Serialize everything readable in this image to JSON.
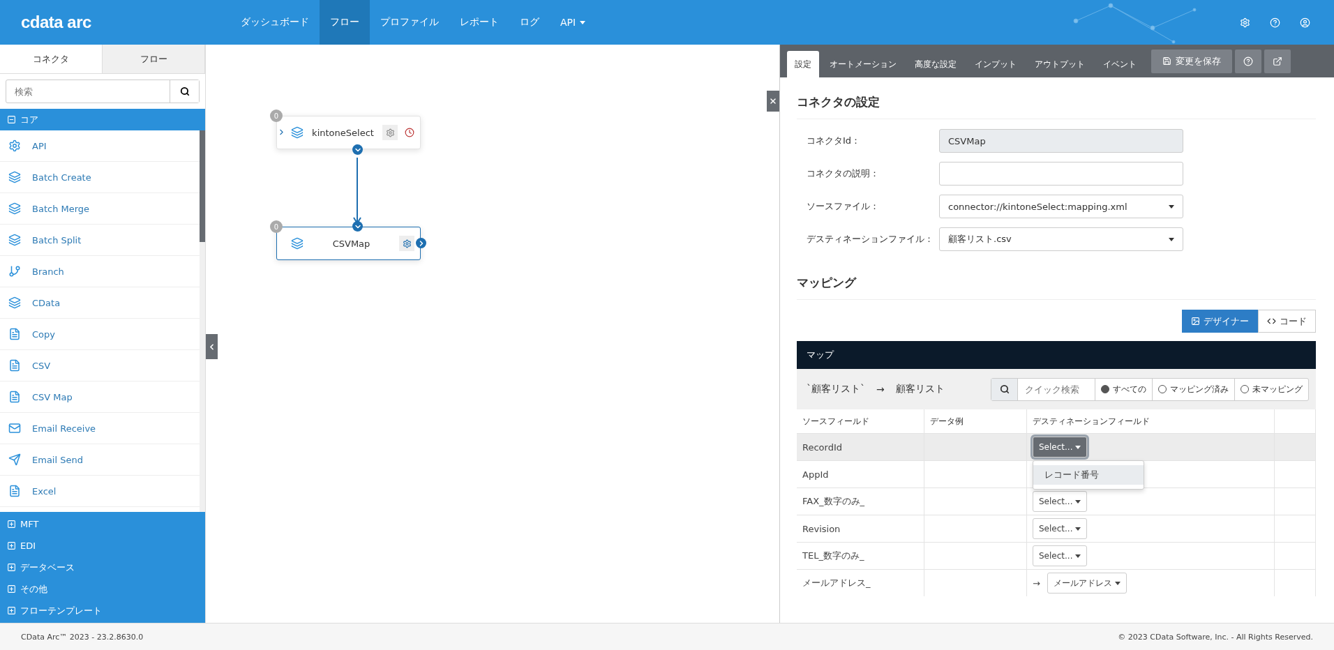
{
  "header": {
    "logo": "cdata arc",
    "nav": [
      {
        "label": "ダッシュボード",
        "selected": false,
        "dropdown": false
      },
      {
        "label": "フロー",
        "selected": true,
        "dropdown": false
      },
      {
        "label": "プロファイル",
        "selected": false,
        "dropdown": false
      },
      {
        "label": "レポート",
        "selected": false,
        "dropdown": false
      },
      {
        "label": "ログ",
        "selected": false,
        "dropdown": false
      },
      {
        "label": "API",
        "selected": false,
        "dropdown": true
      }
    ]
  },
  "sidebar": {
    "tabs": [
      {
        "label": "コネクタ",
        "selected": true
      },
      {
        "label": "フロー",
        "selected": false
      }
    ],
    "search": {
      "placeholder": "検索"
    },
    "groups": [
      {
        "label": "コア",
        "expanded": true,
        "items": [
          "API",
          "Batch Create",
          "Batch Merge",
          "Batch Split",
          "Branch",
          "CData",
          "Copy",
          "CSV",
          "CSV Map",
          "Email Receive",
          "Email Send",
          "Excel"
        ]
      },
      {
        "label": "MFT",
        "expanded": false
      },
      {
        "label": "EDI",
        "expanded": false
      },
      {
        "label": "データベース",
        "expanded": false
      },
      {
        "label": "その他",
        "expanded": false
      },
      {
        "label": "フローテンプレート",
        "expanded": false
      }
    ]
  },
  "canvas": {
    "nodes": [
      {
        "name": "kintoneSelect",
        "badge": "0",
        "selected": false,
        "scheduled": true,
        "has_input": true,
        "has_output": false
      },
      {
        "name": "CSVMap",
        "badge": "0",
        "selected": true,
        "scheduled": false,
        "has_input": false,
        "has_output": true
      }
    ]
  },
  "panel": {
    "tabs": [
      {
        "label": "設定",
        "selected": true
      },
      {
        "label": "オートメーション",
        "selected": false
      },
      {
        "label": "高度な設定",
        "selected": false
      },
      {
        "label": "インプット",
        "selected": false
      },
      {
        "label": "アウトプット",
        "selected": false
      },
      {
        "label": "イベント",
        "selected": false
      }
    ],
    "save_button": "変更を保存",
    "settings_title": "コネクタの設定",
    "fields": [
      {
        "label": "コネクタId：",
        "kind": "readonly",
        "value": "CSVMap"
      },
      {
        "label": "コネクタの説明：",
        "kind": "textarea"
      },
      {
        "label": "ソースファイル：",
        "kind": "select",
        "value": "connector://kintoneSelect:mapping.xml"
      },
      {
        "label": "デスティネーションファイル：",
        "kind": "select",
        "value": "顧客リスト.csv"
      }
    ],
    "mapping_title": "マッピング",
    "view_toggle": [
      {
        "label": "デザイナー",
        "kind": "designer",
        "selected": true
      },
      {
        "label": "コード",
        "kind": "code",
        "selected": false
      }
    ],
    "map": {
      "title": "マップ",
      "source": "`顧客リスト`",
      "arrow": "→",
      "destination": "顧客リスト",
      "search": {
        "placeholder": "クイック検索"
      },
      "filters": [
        {
          "label": "すべての",
          "selected": true
        },
        {
          "label": "マッピング済み",
          "selected": false
        },
        {
          "label": "未マッピング",
          "selected": false
        }
      ],
      "columns": [
        "ソースフィールド",
        "データ例",
        "デスティネーションフィールド"
      ],
      "rows": [
        {
          "source": "RecordId",
          "highlighted": true,
          "dest": {
            "kind": "select",
            "label": "Select...",
            "open": true,
            "options": [
              "レコード番号"
            ]
          }
        },
        {
          "source": "AppId",
          "highlighted": false,
          "dest": {
            "kind": "none"
          }
        },
        {
          "source": "FAX_数字のみ_",
          "highlighted": false,
          "dest": {
            "kind": "select",
            "label": "Select...",
            "open": false
          }
        },
        {
          "source": "Revision",
          "highlighted": false,
          "dest": {
            "kind": "select",
            "label": "Select...",
            "open": false
          }
        },
        {
          "source": "TEL_数字のみ_",
          "highlighted": false,
          "dest": {
            "kind": "select",
            "label": "Select...",
            "open": false
          }
        },
        {
          "source": "メールアドレス_",
          "highlighted": false,
          "dest": {
            "kind": "mapped",
            "arrow": "→",
            "label": "メールアドレス",
            "open": false
          }
        }
      ]
    }
  },
  "footer": {
    "version": "CData Arc™ 2023 - 23.2.8630.0",
    "copyright": "© 2023 CData Software, Inc. - All Rights Reserved."
  }
}
